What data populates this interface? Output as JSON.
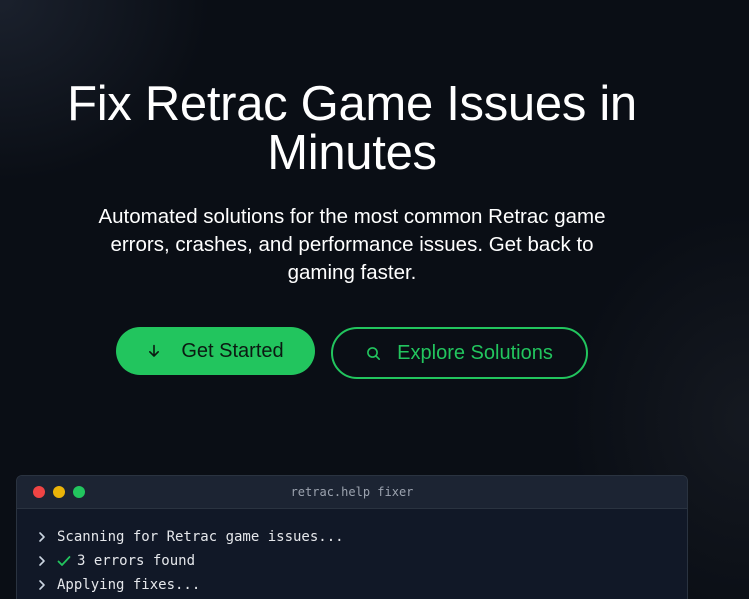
{
  "hero": {
    "title_line1": "Fix Retrac Game Issues in",
    "title_line2": "Minutes",
    "subtitle_line1": "Automated solutions for the most common Retrac game",
    "subtitle_line2": "errors, crashes, and performance issues. Get back to",
    "subtitle_line3": "gaming faster."
  },
  "buttons": {
    "primary_label": "Get Started",
    "primary_icon": "arrow-down-icon",
    "secondary_label": "Explore Solutions",
    "secondary_icon": "search-icon"
  },
  "terminal": {
    "title": "retrac.help fixer",
    "lines": [
      {
        "text": "Scanning for Retrac game issues...",
        "icon": ""
      },
      {
        "text": "3 errors found",
        "icon": "check-icon"
      },
      {
        "text": "Applying fixes...",
        "icon": ""
      }
    ]
  },
  "colors": {
    "accent": "#22c55e",
    "background": "#0a0e15",
    "terminal_bg": "#111827",
    "terminal_header": "#1c2433",
    "dot_red": "#ef4444",
    "dot_yellow": "#eab308",
    "dot_green": "#22c55e"
  }
}
